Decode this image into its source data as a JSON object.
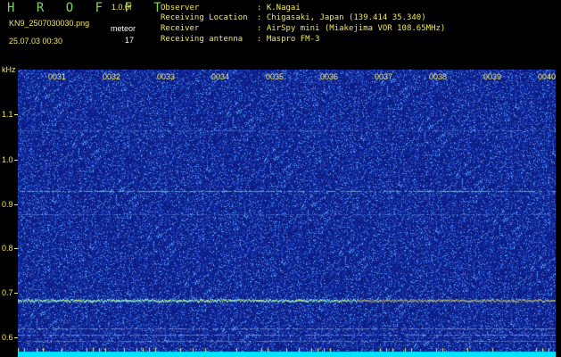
{
  "header": {
    "app_title": "H R O F F T",
    "version": "1.0.0f",
    "filename": "KN9_2507030030.png",
    "meteor_label": "meteor",
    "meteor_count": "17",
    "timestamp": "25.07.03 00:30"
  },
  "info": [
    {
      "label": "Observer",
      "value": ": K.Nagai"
    },
    {
      "label": "Receiving Location",
      "value": ": Chigasaki, Japan (139.414 35.340)"
    },
    {
      "label": "Receiver",
      "value": ": AirSpy mini (Miakejima VOR 108.65MHz)"
    },
    {
      "label": "Receiving antenna",
      "value": ": Maspro FM-3"
    }
  ],
  "spectrogram": {
    "y_unit": "kHz",
    "y_ticks": [
      "1.1",
      "1.0",
      "0.9",
      "0.8",
      "0.7",
      "0.6"
    ],
    "time_ticks": [
      "0031",
      "0032",
      "0033",
      "0034",
      "0035",
      "0036",
      "0037",
      "0038",
      "0039",
      "0040"
    ],
    "colors": {
      "background": "#0c1f88",
      "signal": "#f2e85a",
      "baseline": "#00e5ff"
    }
  }
}
